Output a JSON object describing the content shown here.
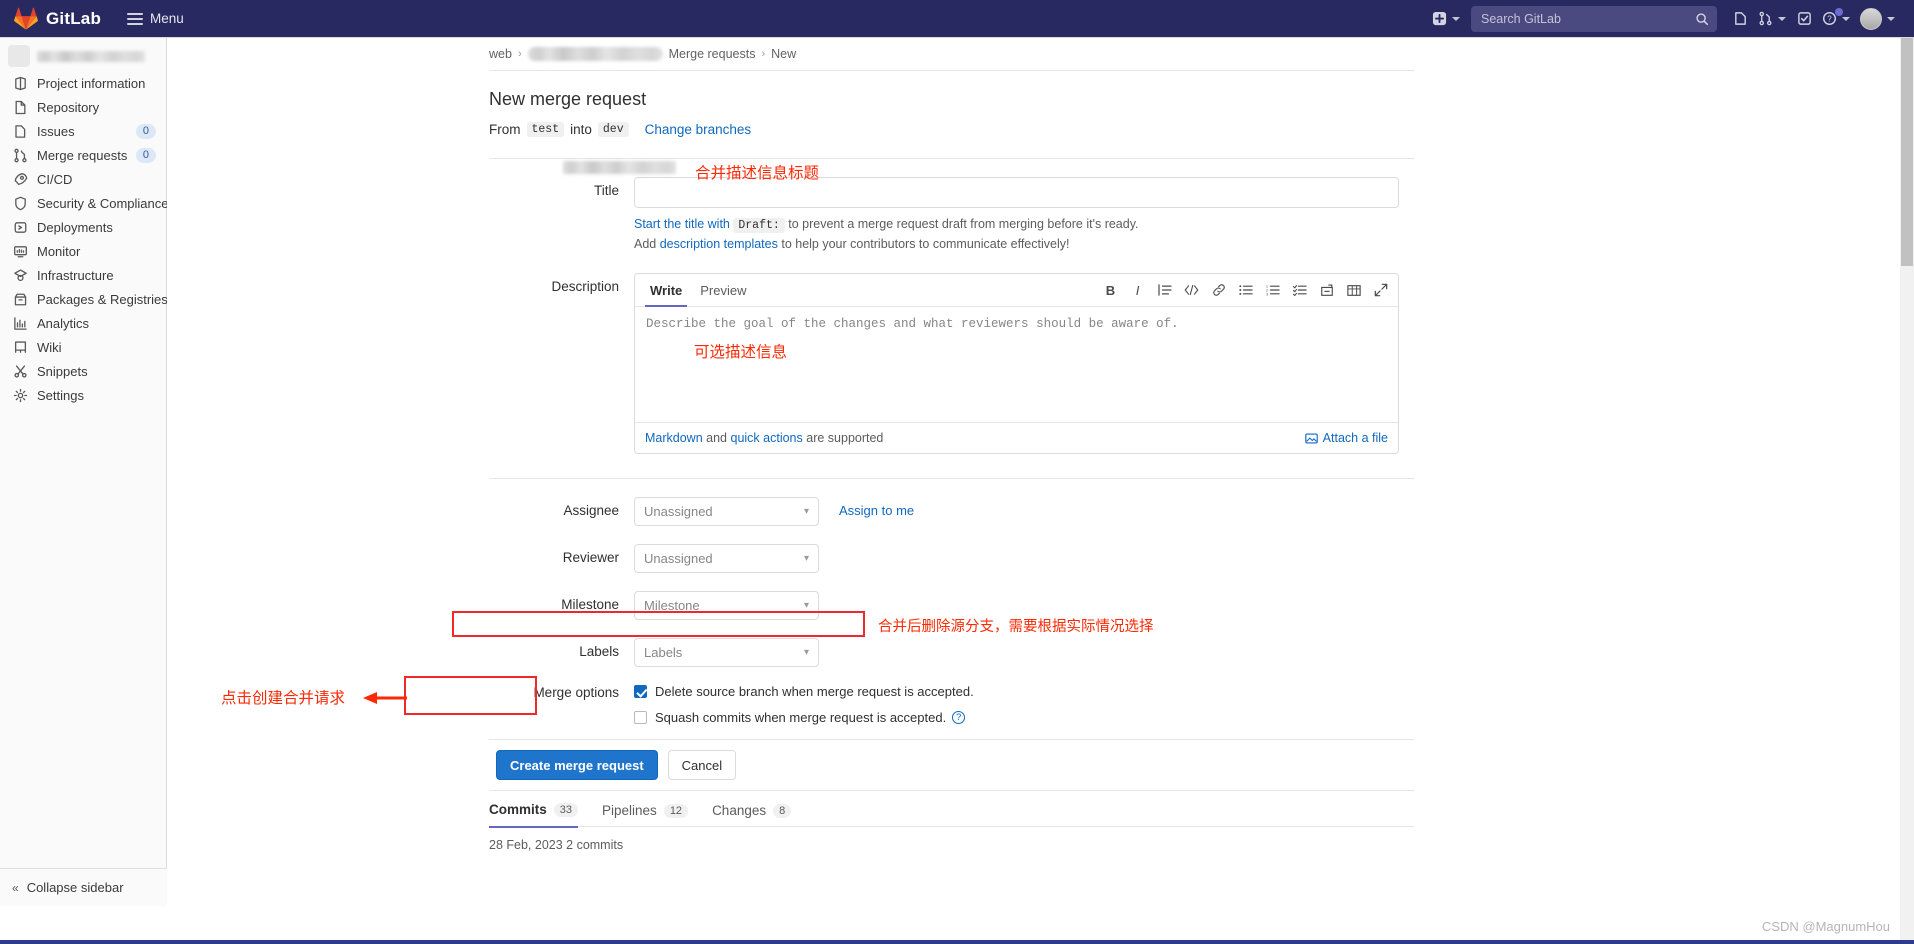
{
  "navbar": {
    "brand": "GitLab",
    "menu_label": "Menu",
    "search_placeholder": "Search GitLab",
    "icons": [
      {
        "name": "create-new-icon",
        "glyph": "+"
      },
      {
        "name": "issues-icon",
        "glyph": "issues"
      },
      {
        "name": "merge-requests-icon",
        "glyph": "merge"
      },
      {
        "name": "todos-icon",
        "glyph": "todo"
      },
      {
        "name": "help-icon",
        "glyph": "?"
      },
      {
        "name": "user-avatar",
        "glyph": "avatar"
      }
    ]
  },
  "sidebar": {
    "project_name_redacted": "",
    "items": [
      {
        "label": "Project information",
        "icon": "project-information-icon",
        "count": null
      },
      {
        "label": "Repository",
        "icon": "repository-icon",
        "count": null
      },
      {
        "label": "Issues",
        "icon": "issues-icon",
        "count": "0"
      },
      {
        "label": "Merge requests",
        "icon": "merge-requests-icon",
        "count": "0"
      },
      {
        "label": "CI/CD",
        "icon": "cicd-icon",
        "count": null
      },
      {
        "label": "Security & Compliance",
        "icon": "shield-icon",
        "count": null
      },
      {
        "label": "Deployments",
        "icon": "deployments-icon",
        "count": null
      },
      {
        "label": "Monitor",
        "icon": "monitor-icon",
        "count": null
      },
      {
        "label": "Infrastructure",
        "icon": "infrastructure-icon",
        "count": null
      },
      {
        "label": "Packages & Registries",
        "icon": "package-icon",
        "count": null
      },
      {
        "label": "Analytics",
        "icon": "analytics-icon",
        "count": null
      },
      {
        "label": "Wiki",
        "icon": "wiki-icon",
        "count": null
      },
      {
        "label": "Snippets",
        "icon": "snippets-icon",
        "count": null
      },
      {
        "label": "Settings",
        "icon": "gear-icon",
        "count": null
      }
    ],
    "collapse_label": "Collapse sidebar"
  },
  "breadcrumb": {
    "root": "web",
    "project_redacted": "",
    "section": "Merge requests",
    "current": "New"
  },
  "page": {
    "title": "New merge request",
    "branch_from_label": "From",
    "source_branch": "test",
    "branch_into_label": "into",
    "target_branch": "dev",
    "change_branches_link": "Change branches"
  },
  "title_field": {
    "label": "Title",
    "value": "",
    "hint1_prefix": "Start the title with",
    "hint1_code": "Draft:",
    "hint1_suffix": "to prevent a merge request draft from merging before it's ready.",
    "hint2_prefix": "Add",
    "hint2_link": "description templates",
    "hint2_suffix": "to help your contributors to communicate effectively!"
  },
  "description_field": {
    "label": "Description",
    "tab_write": "Write",
    "tab_preview": "Preview",
    "placeholder": "Describe the goal of the changes and what reviewers should be aware of.",
    "toolbar": [
      {
        "name": "bold-icon",
        "glyph": "B"
      },
      {
        "name": "italic-icon",
        "glyph": "I"
      },
      {
        "name": "quote-icon",
        "glyph": "quote"
      },
      {
        "name": "code-icon",
        "glyph": "</>"
      },
      {
        "name": "link-icon",
        "glyph": "link"
      },
      {
        "name": "bulleted-list-icon",
        "glyph": "ul"
      },
      {
        "name": "numbered-list-icon",
        "glyph": "ol"
      },
      {
        "name": "task-list-icon",
        "glyph": "task"
      },
      {
        "name": "collapsible-section-icon",
        "glyph": "details"
      },
      {
        "name": "table-icon",
        "glyph": "table"
      },
      {
        "name": "fullscreen-icon",
        "glyph": "expand"
      }
    ],
    "footer_markdown": "Markdown",
    "footer_and": "and",
    "footer_quick_actions": "quick actions",
    "footer_supported": "are supported",
    "attach_label": "Attach a file"
  },
  "fields": {
    "assignee": {
      "label": "Assignee",
      "value": "Unassigned",
      "action_link": "Assign to me"
    },
    "reviewer": {
      "label": "Reviewer",
      "value": "Unassigned"
    },
    "milestone": {
      "label": "Milestone",
      "value": "Milestone"
    },
    "labels": {
      "label": "Labels",
      "value": "Labels"
    }
  },
  "merge_options": {
    "label": "Merge options",
    "delete_source_branch": "Delete source branch when merge request is accepted.",
    "delete_source_branch_checked": true,
    "squash_commits": "Squash commits when merge request is accepted.",
    "squash_commits_checked": false,
    "help_glyph": "?"
  },
  "actions": {
    "submit": "Create merge request",
    "cancel": "Cancel"
  },
  "bottom_tabs": [
    {
      "label": "Commits",
      "count": "33",
      "active": true
    },
    {
      "label": "Pipelines",
      "count": "12",
      "active": false
    },
    {
      "label": "Changes",
      "count": "8",
      "active": false
    }
  ],
  "commit_group_date": "28 Feb, 2023 2 commits",
  "annotations": [
    {
      "name": "annotation-title",
      "text": "合并描述信息标题"
    },
    {
      "name": "annotation-description",
      "text": "可选描述信息"
    },
    {
      "name": "annotation-merge-options",
      "text": "合并后删除源分支，需要根据实际情况选择"
    },
    {
      "name": "annotation-create-button",
      "text": "点击创建合并请求"
    }
  ],
  "watermark": "CSDN @MagnumHou",
  "colors": {
    "navbar_bg": "#292961",
    "accent_blue": "#1f75cb",
    "link_blue": "#1068bf",
    "annotation_red": "#fb2a05",
    "highlight_box_red": "#ef2929",
    "sidebar_bg": "#fafafa"
  }
}
